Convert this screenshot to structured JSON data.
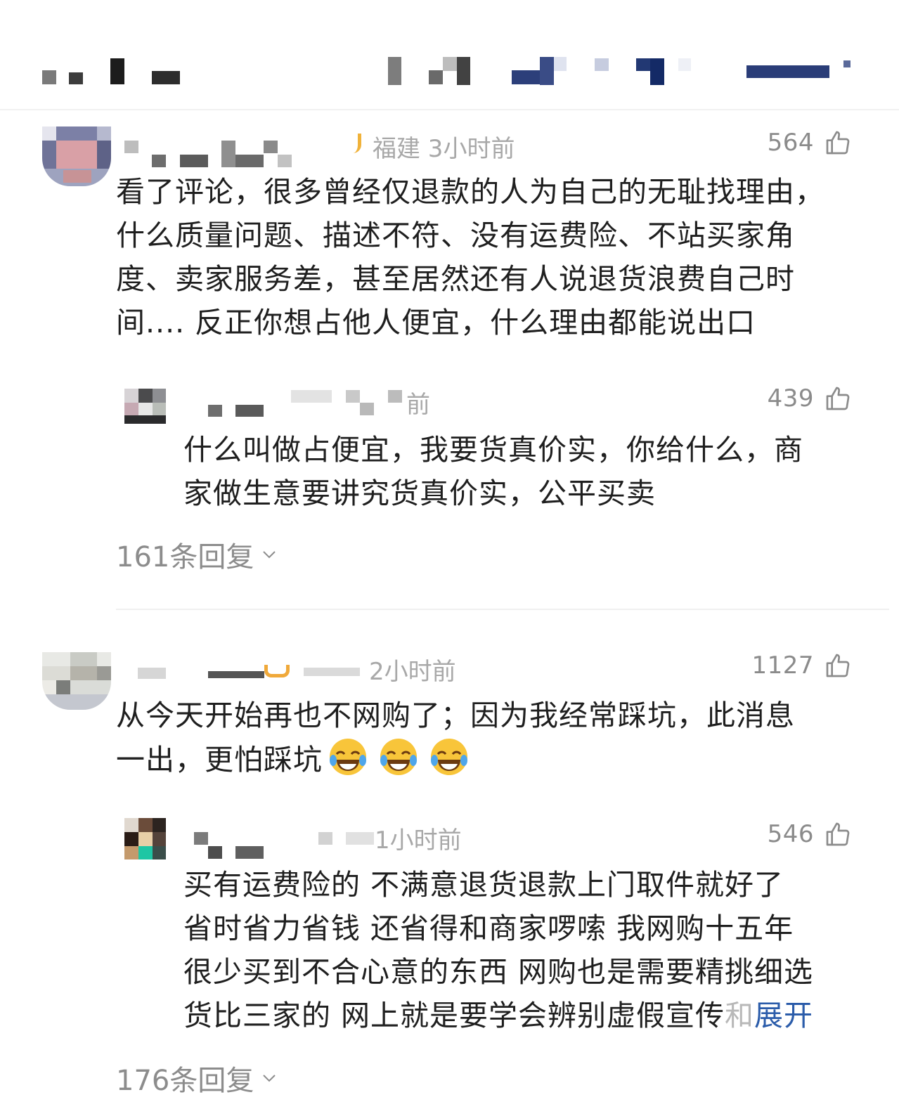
{
  "comments": [
    {
      "meta": "福建 3小时前",
      "likes": "564",
      "text_lines": [
        "看了评论，很多曾经仅退款的人为自己的无耻找理由，",
        "什么质量问题、描述不符、没有运费险、不站买家角",
        "度、卖家服务差，甚至居然还有人说退货浪费自己时",
        "间.... 反正你想占他人便宜，什么理由都能说出口"
      ],
      "reply": {
        "meta": "前",
        "likes": "439",
        "text_lines": [
          "什么叫做占便宜，我要货真价实，你给什么，商",
          "家做生意要讲究货真价实，公平买卖"
        ]
      },
      "reply_count": "161条回复"
    },
    {
      "meta": "2小时前",
      "likes": "1127",
      "text_lines": [
        "从今天开始再也不网购了；因为我经常踩坑，此消息",
        "一出，更怕踩坑"
      ],
      "emoji_count": 3,
      "emoji_name": "laugh-cry-emoji",
      "reply": {
        "meta": "1小时前",
        "likes": "546",
        "text_lines": [
          "买有运费险的 不满意退货退款上门取件就好了",
          "省时省力省钱 还省得和商家啰嗦 我网购十五年",
          "很少买到不合心意的东西 网购也是需要精挑细选",
          "货比三家的 网上就是要学会辨别虚假宣传"
        ],
        "faded_tail": "和",
        "expand_label": "展开"
      },
      "reply_count": "176条回复"
    }
  ],
  "colors": {
    "text": "#1f1f1f",
    "meta": "#a8a8a8",
    "reply_count": "#8c8c8c",
    "expand": "#2b5caa"
  },
  "icons": {
    "like": "thumbs-up-icon",
    "chevron": "chevron-down-icon"
  }
}
